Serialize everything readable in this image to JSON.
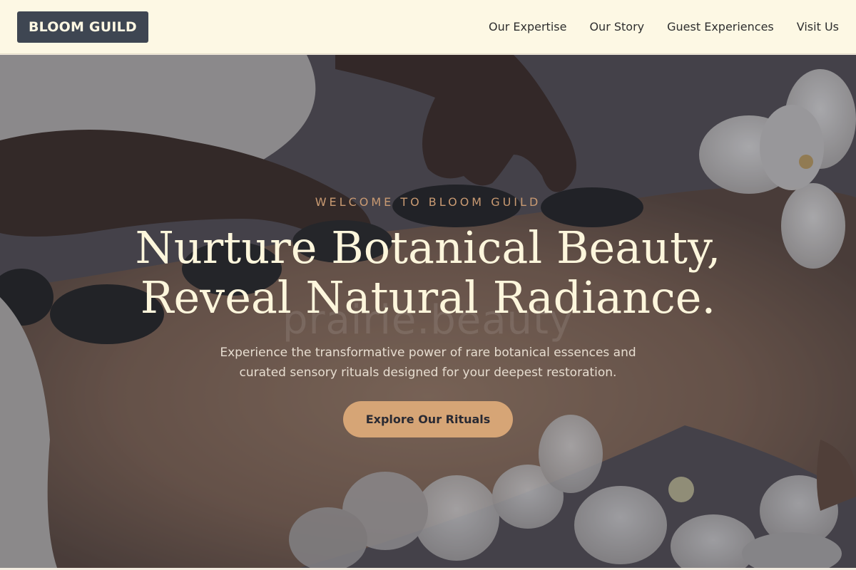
{
  "header": {
    "brand": "BLOOM GUILD",
    "nav": [
      {
        "label": "Our Expertise"
      },
      {
        "label": "Our Story"
      },
      {
        "label": "Guest Experiences"
      },
      {
        "label": "Visit Us"
      }
    ]
  },
  "hero": {
    "eyebrow": "WELCOME TO BLOOM GUILD",
    "headline_line1": "Nurture Botanical Beauty,",
    "headline_line2": "Reveal Natural Radiance.",
    "watermark": "prairie.beauty",
    "subheading": "Experience the transformative power of rare botanical essences and curated sensory rituals designed for your deepest restoration.",
    "cta_label": "Explore Our Rituals",
    "image_icon": "spa-hot-stone-massage-photo"
  },
  "colors": {
    "nav_background": "#fdf8e4",
    "brand_background": "#3e4652",
    "eyebrow": "#c99a72",
    "headline": "#fdf6dc",
    "cta_background": "#d6a576"
  }
}
